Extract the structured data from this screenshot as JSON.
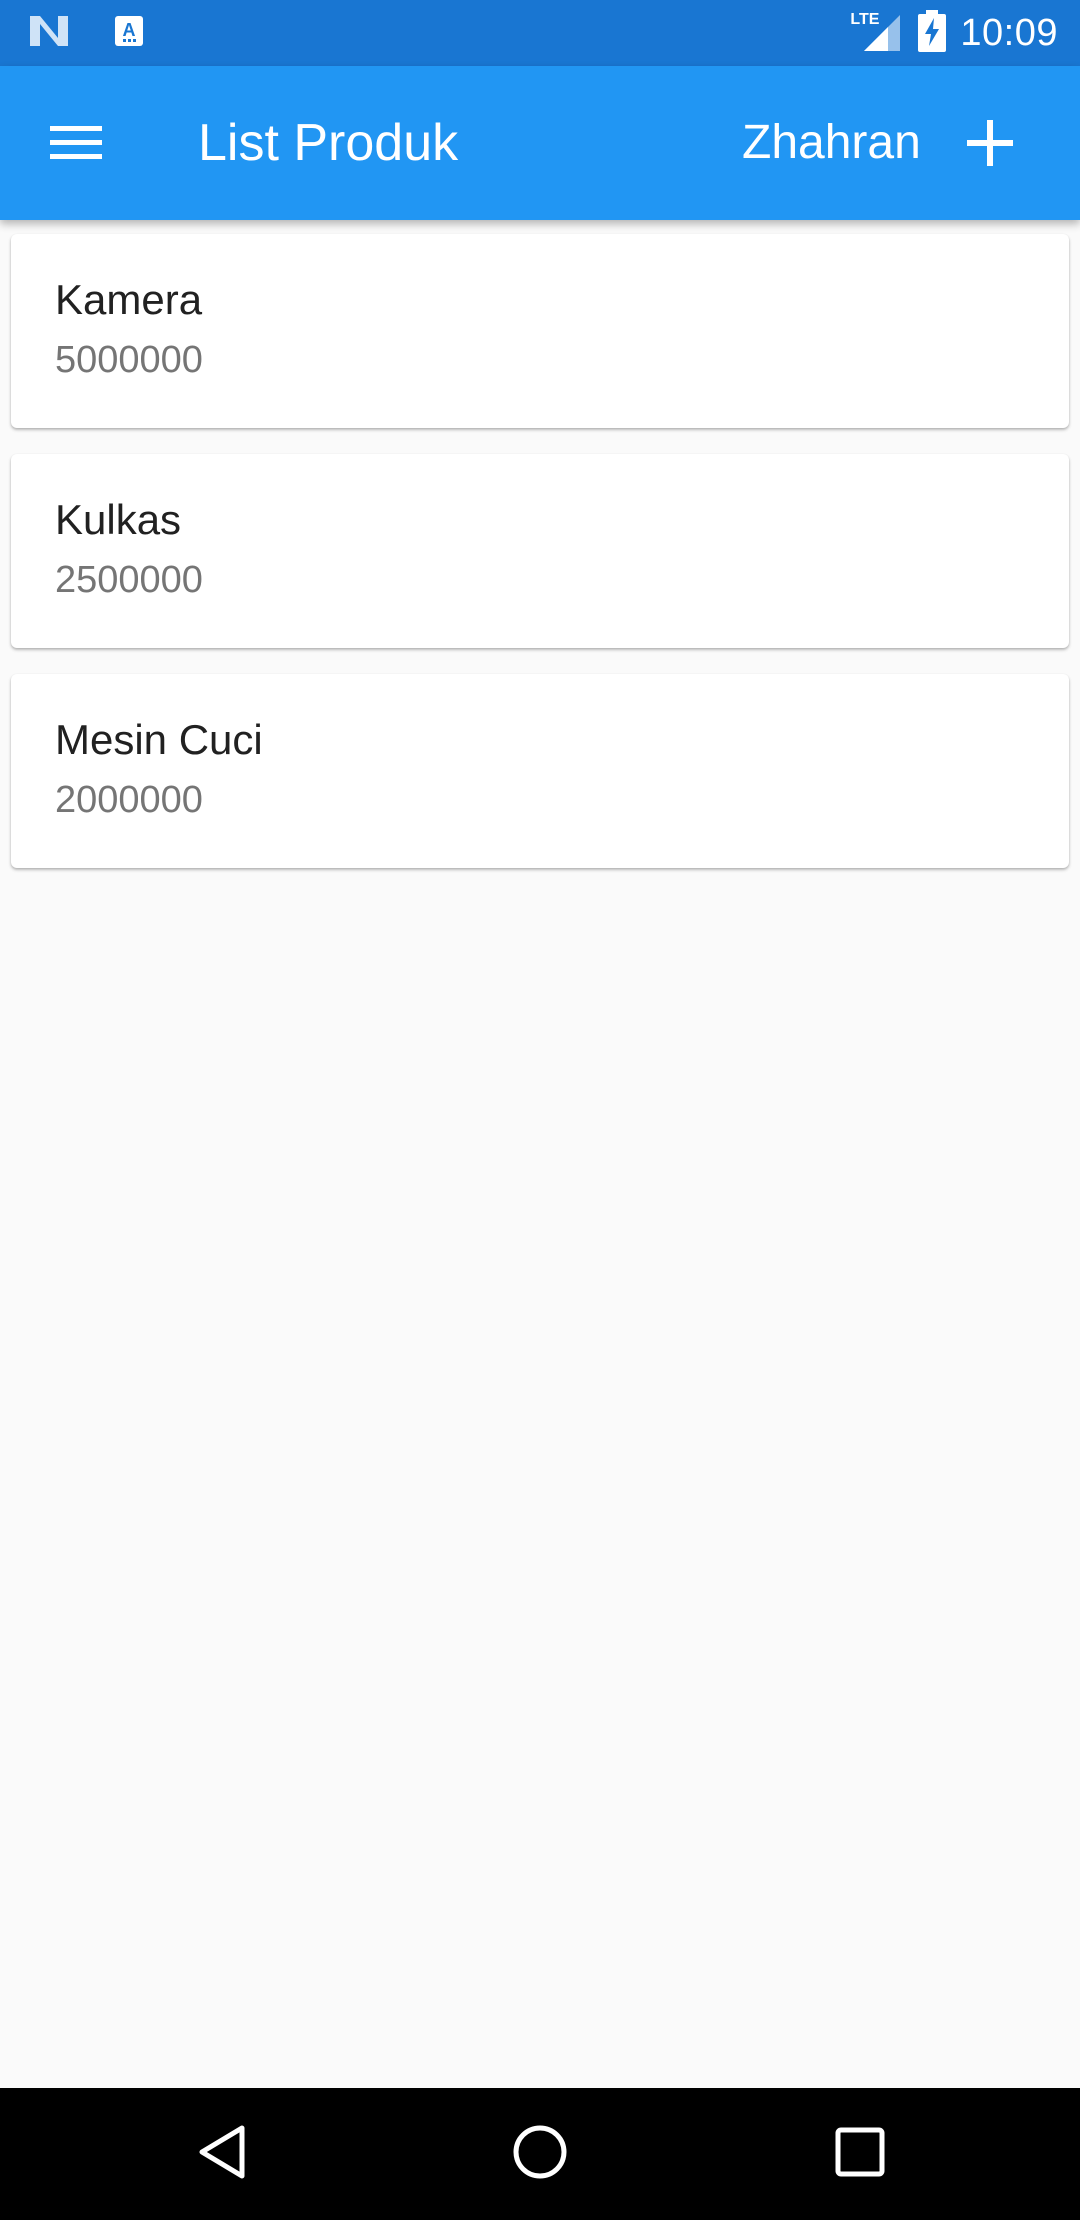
{
  "status_bar": {
    "time": "10:09",
    "network": "LTE",
    "left_icons": [
      "n-logo-icon",
      "app-notification-icon"
    ],
    "right_icons": [
      "lte-signal-icon",
      "battery-charging-icon"
    ]
  },
  "app_bar": {
    "title": "List Produk",
    "user_name": "Zhahran",
    "menu_icon": "menu-icon",
    "add_icon": "plus-icon",
    "color": "#2196f3"
  },
  "products": [
    {
      "name": "Kamera",
      "price": "5000000"
    },
    {
      "name": "Kulkas",
      "price": "2500000"
    },
    {
      "name": "Mesin Cuci",
      "price": "2000000"
    }
  ],
  "nav_bar": {
    "icons": [
      "back-icon",
      "home-icon",
      "recents-icon"
    ]
  }
}
